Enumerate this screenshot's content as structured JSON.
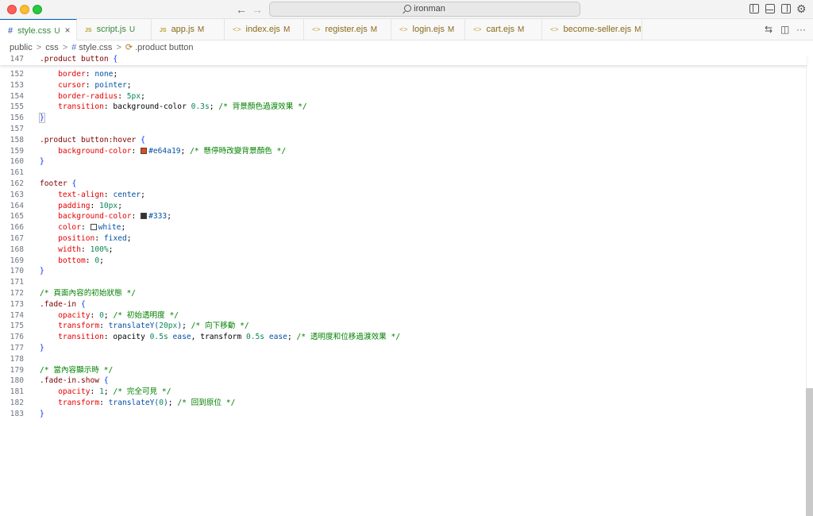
{
  "titlebar": {
    "search_text": "ironman"
  },
  "tabs": [
    {
      "icon": "#",
      "name": "style.css",
      "status": "U",
      "kind": "css",
      "active": true,
      "close": "×"
    },
    {
      "icon": "JS",
      "name": "script.js",
      "status": "U",
      "kind": "js"
    },
    {
      "icon": "JS",
      "name": "app.js",
      "status": "M",
      "kind": "js"
    },
    {
      "icon": "<>",
      "name": "index.ejs",
      "status": "M",
      "kind": "ejs"
    },
    {
      "icon": "<>",
      "name": "register.ejs",
      "status": "M",
      "kind": "ejs"
    },
    {
      "icon": "<>",
      "name": "login.ejs",
      "status": "M",
      "kind": "ejs"
    },
    {
      "icon": "<>",
      "name": "cart.ejs",
      "status": "M",
      "kind": "ejs"
    },
    {
      "icon": "<>",
      "name": "become-seller.ejs",
      "status": "M",
      "kind": "ejs"
    }
  ],
  "breadcrumb": {
    "p1": "public",
    "p2": "css",
    "p3_icon": "#",
    "p3": "style.css",
    "p4_icon": "⟳",
    "p4": ".product button",
    "sep": ">"
  },
  "colors": {
    "accent": "#005fb8",
    "hover_swatch": "#e64a19",
    "footer_swatch": "#333333",
    "white_swatch": "#ffffff"
  },
  "icons": [
    "back-arrow-icon",
    "forward-arrow-icon",
    "search-icon",
    "toggle-sidebar-icon",
    "toggle-panel-icon",
    "toggle-secondary-sidebar-icon",
    "gear-icon",
    "compare-changes-icon",
    "split-editor-icon",
    "more-actions-icon"
  ],
  "editor": {
    "sticky_line": {
      "n": "147",
      "tokens": [
        [
          "sel",
          ".product button"
        ],
        [
          "pun",
          " "
        ],
        [
          "brace",
          "{"
        ]
      ]
    },
    "lines": [
      {
        "n": "152",
        "tokens": [
          [
            "pun",
            "    "
          ],
          [
            "prop",
            "border"
          ],
          [
            "pun",
            ": "
          ],
          [
            "val",
            "none"
          ],
          [
            "pun",
            ";"
          ]
        ]
      },
      {
        "n": "153",
        "tokens": [
          [
            "pun",
            "    "
          ],
          [
            "prop",
            "cursor"
          ],
          [
            "pun",
            ": "
          ],
          [
            "val",
            "pointer"
          ],
          [
            "pun",
            ";"
          ]
        ]
      },
      {
        "n": "154",
        "tokens": [
          [
            "pun",
            "    "
          ],
          [
            "prop",
            "border-radius"
          ],
          [
            "pun",
            ": "
          ],
          [
            "num",
            "5px"
          ],
          [
            "pun",
            ";"
          ]
        ]
      },
      {
        "n": "155",
        "tokens": [
          [
            "pun",
            "    "
          ],
          [
            "prop",
            "transition"
          ],
          [
            "pun",
            ": background-color "
          ],
          [
            "num",
            "0.3s"
          ],
          [
            "pun",
            "; "
          ],
          [
            "cmt",
            "/* 背景顏色過渡效果 */"
          ]
        ]
      },
      {
        "n": "156",
        "tokens": [
          [
            "brace",
            "}"
          ]
        ],
        "hl": true
      },
      {
        "n": "157",
        "tokens": []
      },
      {
        "n": "158",
        "tokens": [
          [
            "sel",
            ".product button:hover"
          ],
          [
            "pun",
            " "
          ],
          [
            "brace",
            "{"
          ]
        ]
      },
      {
        "n": "159",
        "tokens": [
          [
            "pun",
            "    "
          ],
          [
            "prop",
            "background-color"
          ],
          [
            "pun",
            ": "
          ],
          [
            "swatch",
            "#e64a19"
          ],
          [
            "val",
            "#e64a19"
          ],
          [
            "pun",
            "; "
          ],
          [
            "cmt",
            "/* 懸停時改變背景顏色 */"
          ]
        ]
      },
      {
        "n": "160",
        "tokens": [
          [
            "brace",
            "}"
          ]
        ]
      },
      {
        "n": "161",
        "tokens": []
      },
      {
        "n": "162",
        "tokens": [
          [
            "sel",
            "footer"
          ],
          [
            "pun",
            " "
          ],
          [
            "brace",
            "{"
          ]
        ]
      },
      {
        "n": "163",
        "tokens": [
          [
            "pun",
            "    "
          ],
          [
            "prop",
            "text-align"
          ],
          [
            "pun",
            ": "
          ],
          [
            "val",
            "center"
          ],
          [
            "pun",
            ";"
          ]
        ]
      },
      {
        "n": "164",
        "tokens": [
          [
            "pun",
            "    "
          ],
          [
            "prop",
            "padding"
          ],
          [
            "pun",
            ": "
          ],
          [
            "num",
            "10px"
          ],
          [
            "pun",
            ";"
          ]
        ]
      },
      {
        "n": "165",
        "tokens": [
          [
            "pun",
            "    "
          ],
          [
            "prop",
            "background-color"
          ],
          [
            "pun",
            ": "
          ],
          [
            "swatch",
            "#333333"
          ],
          [
            "val",
            "#333"
          ],
          [
            "pun",
            ";"
          ]
        ]
      },
      {
        "n": "166",
        "tokens": [
          [
            "pun",
            "    "
          ],
          [
            "prop",
            "color"
          ],
          [
            "pun",
            ": "
          ],
          [
            "swatch",
            "#ffffff"
          ],
          [
            "val",
            "white"
          ],
          [
            "pun",
            ";"
          ]
        ]
      },
      {
        "n": "167",
        "tokens": [
          [
            "pun",
            "    "
          ],
          [
            "prop",
            "position"
          ],
          [
            "pun",
            ": "
          ],
          [
            "val",
            "fixed"
          ],
          [
            "pun",
            ";"
          ]
        ]
      },
      {
        "n": "168",
        "tokens": [
          [
            "pun",
            "    "
          ],
          [
            "prop",
            "width"
          ],
          [
            "pun",
            ": "
          ],
          [
            "num",
            "100%"
          ],
          [
            "pun",
            ";"
          ]
        ]
      },
      {
        "n": "169",
        "tokens": [
          [
            "pun",
            "    "
          ],
          [
            "prop",
            "bottom"
          ],
          [
            "pun",
            ": "
          ],
          [
            "num",
            "0"
          ],
          [
            "pun",
            ";"
          ]
        ]
      },
      {
        "n": "170",
        "tokens": [
          [
            "brace",
            "}"
          ]
        ]
      },
      {
        "n": "171",
        "tokens": []
      },
      {
        "n": "172",
        "tokens": [
          [
            "cmt",
            "/* 頁面內容的初始狀態 */"
          ]
        ]
      },
      {
        "n": "173",
        "tokens": [
          [
            "sel",
            ".fade-in"
          ],
          [
            "pun",
            " "
          ],
          [
            "brace",
            "{"
          ]
        ]
      },
      {
        "n": "174",
        "tokens": [
          [
            "pun",
            "    "
          ],
          [
            "prop",
            "opacity"
          ],
          [
            "pun",
            ": "
          ],
          [
            "num",
            "0"
          ],
          [
            "pun",
            "; "
          ],
          [
            "cmt",
            "/* 初始透明度 */"
          ]
        ]
      },
      {
        "n": "175",
        "tokens": [
          [
            "pun",
            "    "
          ],
          [
            "prop",
            "transform"
          ],
          [
            "pun",
            ": "
          ],
          [
            "val",
            "translateY("
          ],
          [
            "num",
            "20px"
          ],
          [
            "val",
            ")"
          ],
          [
            "pun",
            "; "
          ],
          [
            "cmt",
            "/* 向下移動 */"
          ]
        ]
      },
      {
        "n": "176",
        "tokens": [
          [
            "pun",
            "    "
          ],
          [
            "prop",
            "transition"
          ],
          [
            "pun",
            ": opacity "
          ],
          [
            "num",
            "0.5s"
          ],
          [
            "pun",
            " "
          ],
          [
            "val",
            "ease"
          ],
          [
            "pun",
            ", transform "
          ],
          [
            "num",
            "0.5s"
          ],
          [
            "pun",
            " "
          ],
          [
            "val",
            "ease"
          ],
          [
            "pun",
            "; "
          ],
          [
            "cmt",
            "/* 透明度和位移過渡效果 */"
          ]
        ]
      },
      {
        "n": "177",
        "tokens": [
          [
            "brace",
            "}"
          ]
        ]
      },
      {
        "n": "178",
        "tokens": []
      },
      {
        "n": "179",
        "tokens": [
          [
            "cmt",
            "/* 當內容顯示時 */"
          ]
        ]
      },
      {
        "n": "180",
        "tokens": [
          [
            "sel",
            ".fade-in.show"
          ],
          [
            "pun",
            " "
          ],
          [
            "brace",
            "{"
          ]
        ]
      },
      {
        "n": "181",
        "tokens": [
          [
            "pun",
            "    "
          ],
          [
            "prop",
            "opacity"
          ],
          [
            "pun",
            ": "
          ],
          [
            "num",
            "1"
          ],
          [
            "pun",
            "; "
          ],
          [
            "cmt",
            "/* 完全可見 */"
          ]
        ]
      },
      {
        "n": "182",
        "tokens": [
          [
            "pun",
            "    "
          ],
          [
            "prop",
            "transform"
          ],
          [
            "pun",
            ": "
          ],
          [
            "val",
            "translateY("
          ],
          [
            "num",
            "0"
          ],
          [
            "val",
            ")"
          ],
          [
            "pun",
            "; "
          ],
          [
            "cmt",
            "/* 回到原位 */"
          ]
        ]
      },
      {
        "n": "183",
        "tokens": [
          [
            "brace",
            "}"
          ]
        ]
      }
    ]
  }
}
